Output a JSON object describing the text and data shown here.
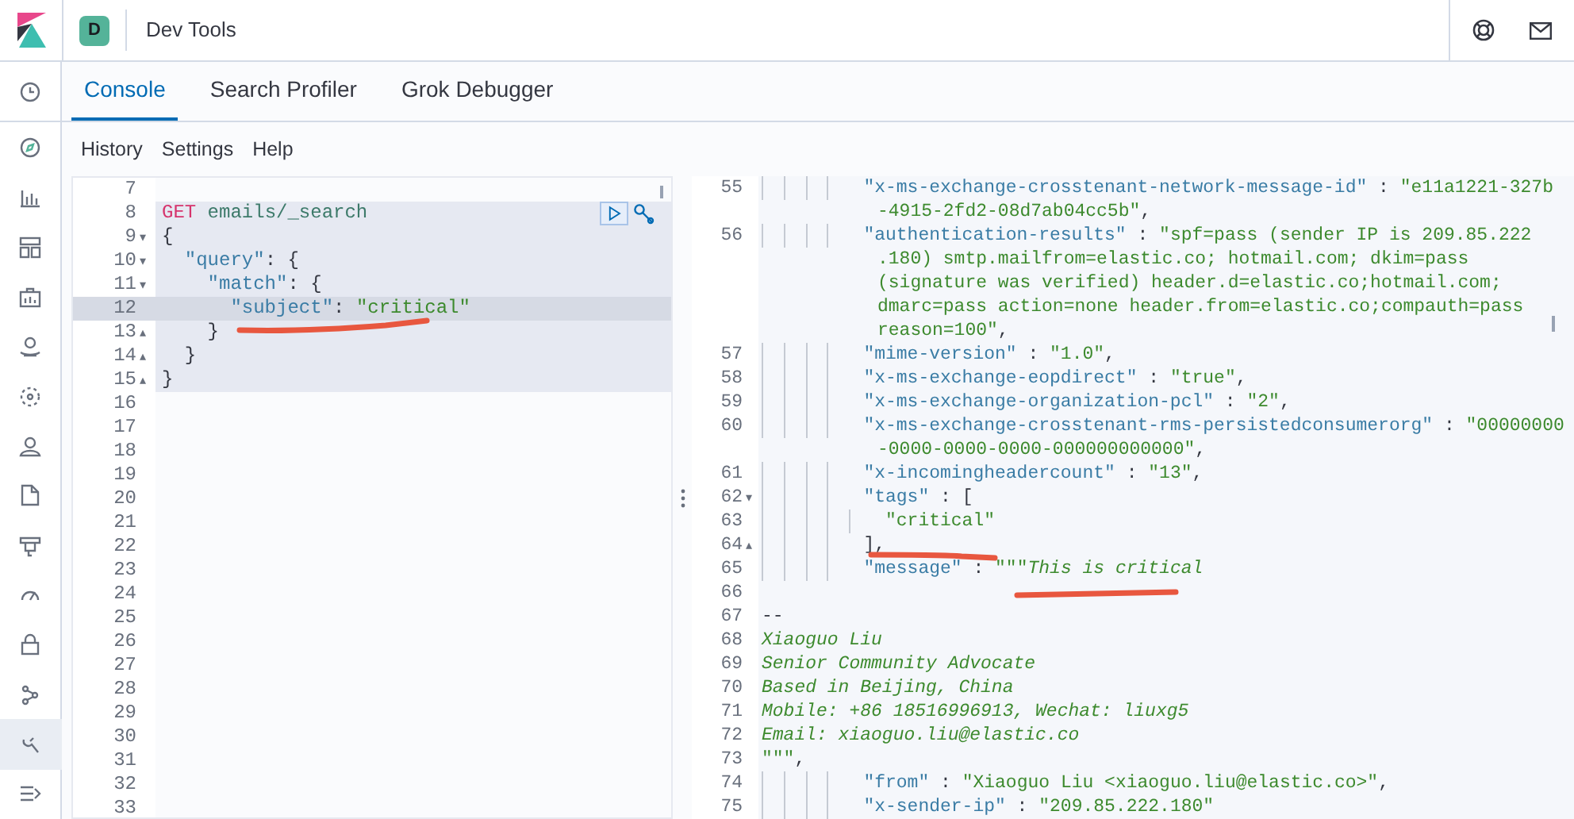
{
  "header": {
    "space_initial": "D",
    "title": "Dev Tools"
  },
  "sidebar": {
    "items": [
      {
        "selected": false
      },
      {
        "selected": false
      },
      {
        "selected": false
      },
      {
        "selected": false
      },
      {
        "selected": false
      },
      {
        "selected": false
      },
      {
        "selected": false
      },
      {
        "selected": false
      },
      {
        "selected": false
      },
      {
        "selected": false
      },
      {
        "selected": false
      },
      {
        "selected": false
      },
      {
        "selected": false
      },
      {
        "selected": true
      },
      {
        "selected": false
      }
    ]
  },
  "tabs": [
    {
      "label": "Console",
      "selected": true
    },
    {
      "label": "Search Profiler",
      "selected": false
    },
    {
      "label": "Grok Debugger",
      "selected": false
    }
  ],
  "menu": [
    "History",
    "Settings",
    "Help"
  ],
  "request_editor": {
    "lines": [
      {
        "number": "7",
        "in_request": false,
        "current": false
      },
      {
        "number": "8",
        "in_request": true,
        "current": false,
        "segments": [
          {
            "kind": "method",
            "text": "GET"
          },
          {
            "kind": "url",
            "text": " emails/_search"
          }
        ]
      },
      {
        "number": "9",
        "fold": "▾",
        "in_request": true,
        "current": false,
        "segments": [
          {
            "kind": "punct",
            "text": "{"
          }
        ]
      },
      {
        "number": "10",
        "fold": "▾",
        "in_request": true,
        "current": false,
        "segments": [
          {
            "kind": "key",
            "text": "  \"query\""
          },
          {
            "kind": "punct",
            "text": ": {"
          }
        ]
      },
      {
        "number": "11",
        "fold": "▾",
        "in_request": true,
        "current": false,
        "segments": [
          {
            "kind": "key",
            "text": "    \"match\""
          },
          {
            "kind": "punct",
            "text": ": {"
          }
        ]
      },
      {
        "number": "12",
        "in_request": true,
        "current": true,
        "segments": [
          {
            "kind": "key",
            "text": "      \"subject\""
          },
          {
            "kind": "punct",
            "text": ": "
          },
          {
            "kind": "string",
            "text": "\"critical\""
          }
        ]
      },
      {
        "number": "13",
        "fold": "▴",
        "in_request": true,
        "current": false,
        "segments": [
          {
            "kind": "punct",
            "text": "    }"
          }
        ]
      },
      {
        "number": "14",
        "fold": "▴",
        "in_request": true,
        "current": false,
        "segments": [
          {
            "kind": "punct",
            "text": "  }"
          }
        ]
      },
      {
        "number": "15",
        "fold": "▴",
        "in_request": true,
        "current": false,
        "segments": [
          {
            "kind": "punct",
            "text": "}"
          }
        ]
      },
      {
        "number": "16",
        "in_request": false,
        "current": false
      },
      {
        "number": "17",
        "in_request": false,
        "current": false
      },
      {
        "number": "18",
        "in_request": false,
        "current": false
      },
      {
        "number": "19",
        "in_request": false,
        "current": false
      },
      {
        "number": "20",
        "in_request": false,
        "current": false
      },
      {
        "number": "21",
        "in_request": false,
        "current": false
      },
      {
        "number": "22",
        "in_request": false,
        "current": false
      },
      {
        "number": "23",
        "in_request": false,
        "current": false
      },
      {
        "number": "24",
        "in_request": false,
        "current": false
      },
      {
        "number": "25",
        "in_request": false,
        "current": false
      },
      {
        "number": "26",
        "in_request": false,
        "current": false
      },
      {
        "number": "27",
        "in_request": false,
        "current": false
      },
      {
        "number": "28",
        "in_request": false,
        "current": false
      },
      {
        "number": "29",
        "in_request": false,
        "current": false
      },
      {
        "number": "30",
        "in_request": false,
        "current": false
      },
      {
        "number": "31",
        "in_request": false,
        "current": false
      },
      {
        "number": "32",
        "in_request": false,
        "current": false
      },
      {
        "number": "33",
        "in_request": false,
        "current": false
      }
    ]
  },
  "response_viewer": {
    "lines": [
      {
        "kind": "field",
        "number": "55",
        "segments": [
          {
            "kind": "key",
            "text": "\"x-ms-exchange-crosstenant-network-message-id\""
          },
          {
            "kind": "punct",
            "text": " : "
          },
          {
            "kind": "string",
            "text": "\"e11a1221-327b"
          }
        ]
      },
      {
        "kind": "wrap",
        "segments": [
          {
            "kind": "string",
            "text": "-4915-2fd2-08d7ab04cc5b\""
          },
          {
            "kind": "punct",
            "text": ","
          }
        ]
      },
      {
        "kind": "field",
        "number": "56",
        "segments": [
          {
            "kind": "key",
            "text": "\"authentication-results\""
          },
          {
            "kind": "punct",
            "text": " : "
          },
          {
            "kind": "string",
            "text": "\"spf=pass (sender IP is 209.85.222"
          }
        ]
      },
      {
        "kind": "wrap",
        "segments": [
          {
            "kind": "string",
            "text": ".180) smtp.mailfrom=elastic.co; hotmail.com; dkim=pass"
          }
        ]
      },
      {
        "kind": "wrap",
        "segments": [
          {
            "kind": "string",
            "text": "(signature was verified) header.d=elastic.co;hotmail.com;"
          }
        ]
      },
      {
        "kind": "wrap",
        "segments": [
          {
            "kind": "string",
            "text": "dmarc=pass action=none header.from=elastic.co;compauth=pass"
          }
        ]
      },
      {
        "kind": "wrap",
        "segments": [
          {
            "kind": "string",
            "text": "reason=100\""
          },
          {
            "kind": "punct",
            "text": ","
          }
        ]
      },
      {
        "kind": "field",
        "number": "57",
        "segments": [
          {
            "kind": "key",
            "text": "\"mime-version\""
          },
          {
            "kind": "punct",
            "text": " : "
          },
          {
            "kind": "string",
            "text": "\"1.0\""
          },
          {
            "kind": "punct",
            "text": ","
          }
        ]
      },
      {
        "kind": "field",
        "number": "58",
        "segments": [
          {
            "kind": "key",
            "text": "\"x-ms-exchange-eopdirect\""
          },
          {
            "kind": "punct",
            "text": " : "
          },
          {
            "kind": "string",
            "text": "\"true\""
          },
          {
            "kind": "punct",
            "text": ","
          }
        ]
      },
      {
        "kind": "field",
        "number": "59",
        "segments": [
          {
            "kind": "key",
            "text": "\"x-ms-exchange-organization-pcl\""
          },
          {
            "kind": "punct",
            "text": " : "
          },
          {
            "kind": "string",
            "text": "\"2\""
          },
          {
            "kind": "punct",
            "text": ","
          }
        ]
      },
      {
        "kind": "field",
        "number": "60",
        "segments": [
          {
            "kind": "key",
            "text": "\"x-ms-exchange-crosstenant-rms-persistedconsumerorg\""
          },
          {
            "kind": "punct",
            "text": " : "
          },
          {
            "kind": "string",
            "text": "\"00000000"
          }
        ]
      },
      {
        "kind": "wrap",
        "segments": [
          {
            "kind": "string",
            "text": "-0000-0000-0000-000000000000\""
          },
          {
            "kind": "punct",
            "text": ","
          }
        ]
      },
      {
        "kind": "field",
        "number": "61",
        "segments": [
          {
            "kind": "key",
            "text": "\"x-incomingheadercount\""
          },
          {
            "kind": "punct",
            "text": " : "
          },
          {
            "kind": "string",
            "text": "\"13\""
          },
          {
            "kind": "punct",
            "text": ","
          }
        ]
      },
      {
        "kind": "field",
        "number": "62",
        "fold": "▾",
        "segments": [
          {
            "kind": "key",
            "text": "\"tags\""
          },
          {
            "kind": "punct",
            "text": " : ["
          }
        ]
      },
      {
        "kind": "item",
        "number": "63",
        "segments": [
          {
            "kind": "string",
            "text": "\"critical\""
          }
        ]
      },
      {
        "kind": "field",
        "number": "64",
        "fold": "▴",
        "segments": [
          {
            "kind": "punct",
            "text": "],"
          }
        ]
      },
      {
        "kind": "field",
        "number": "65",
        "segments": [
          {
            "kind": "key",
            "text": "\"message\""
          },
          {
            "kind": "punct",
            "text": " : "
          },
          {
            "kind": "string",
            "text": "\"\"\""
          },
          {
            "kind": "italic",
            "text": "This is critical"
          }
        ]
      },
      {
        "kind": "plain",
        "number": "66"
      },
      {
        "kind": "plain",
        "number": "67",
        "segments": [
          {
            "kind": "punct",
            "text": "--"
          }
        ]
      },
      {
        "kind": "plain",
        "number": "68",
        "segments": [
          {
            "kind": "italic",
            "text": "Xiaoguo Liu"
          }
        ]
      },
      {
        "kind": "plain",
        "number": "69",
        "segments": [
          {
            "kind": "italic",
            "text": "Senior Community Advocate"
          }
        ]
      },
      {
        "kind": "plain",
        "number": "70",
        "segments": [
          {
            "kind": "italic",
            "text": "Based in Beijing, China"
          }
        ]
      },
      {
        "kind": "plain",
        "number": "71",
        "segments": [
          {
            "kind": "italic",
            "text": "Mobile: +86 18516996913, Wechat: liuxg5"
          }
        ]
      },
      {
        "kind": "plain",
        "number": "72",
        "segments": [
          {
            "kind": "italic",
            "text": "Email: xiaoguo.liu@elastic.co"
          }
        ]
      },
      {
        "kind": "plain",
        "number": "73",
        "segments": [
          {
            "kind": "string",
            "text": "\"\"\""
          },
          {
            "kind": "punct",
            "text": ","
          }
        ]
      },
      {
        "kind": "field",
        "number": "74",
        "segments": [
          {
            "kind": "key",
            "text": "\"from\""
          },
          {
            "kind": "punct",
            "text": " : "
          },
          {
            "kind": "string",
            "text": "\"Xiaoguo Liu <xiaoguo.liu@elastic.co>\""
          },
          {
            "kind": "punct",
            "text": ","
          }
        ]
      },
      {
        "kind": "field",
        "number": "75",
        "segments": [
          {
            "kind": "key",
            "text": "\"x-sender-ip\""
          },
          {
            "kind": "punct",
            "text": " : "
          },
          {
            "kind": "string",
            "text": "\"209.85.222.180\""
          }
        ]
      }
    ]
  }
}
